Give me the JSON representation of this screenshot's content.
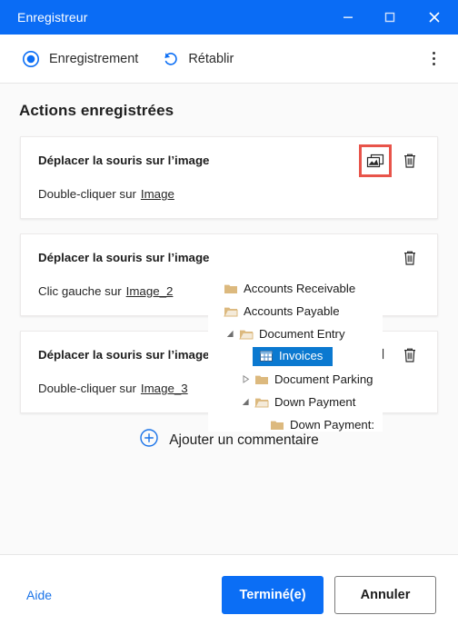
{
  "window": {
    "title": "Enregistreur",
    "controls": {
      "minimize": "minimize",
      "maximize": "maximize",
      "close": "close"
    },
    "accent_color": "#0a6cf5"
  },
  "toolbar": {
    "record_label": "Enregistrement",
    "redo_label": "Rétablir",
    "overflow_label": "more-options"
  },
  "main": {
    "section_title": "Actions enregistrées",
    "cards": [
      {
        "title": "Déplacer la souris sur l’image",
        "action_prefix": "Double-cliquer sur",
        "action_target": "Image",
        "image_button": "image-preview",
        "delete_button": "delete",
        "highlighted": true
      },
      {
        "title": "Déplacer la souris sur l’image",
        "action_prefix": "Clic gauche sur",
        "action_target": "Image_2",
        "image_button": "image-preview",
        "delete_button": "delete",
        "highlighted": false
      },
      {
        "title": "Déplacer la souris sur l’image",
        "action_prefix": "Double-cliquer sur",
        "action_target": "Image_3",
        "image_button": "image-preview",
        "delete_button": "delete",
        "highlighted": false
      }
    ],
    "add_comment_label": "Ajouter un commentaire"
  },
  "tree_overlay": {
    "rows": [
      {
        "label": "Accounts Receivable",
        "indent": 0,
        "icon": "folder-closed",
        "expander": "none",
        "selected": false
      },
      {
        "label": "Accounts Payable",
        "indent": 0,
        "icon": "folder-open",
        "expander": "none",
        "selected": false
      },
      {
        "label": "Document Entry",
        "indent": 1,
        "icon": "folder-open",
        "expander": "expanded",
        "selected": false
      },
      {
        "label": "Invoices",
        "indent": 2,
        "icon": "table-grid",
        "expander": "none",
        "selected": true
      },
      {
        "label": "Document Parking",
        "indent": 2,
        "icon": "folder-closed",
        "expander": "collapsed",
        "selected": false
      },
      {
        "label": "Down Payment",
        "indent": 2,
        "icon": "folder-open",
        "expander": "expanded",
        "selected": false
      },
      {
        "label": "Down Payment:",
        "indent": 3,
        "icon": "folder-closed",
        "expander": "none",
        "selected": false
      }
    ],
    "selection_color": "#0b79d0",
    "folder_color": "#dcb97e"
  },
  "footer": {
    "help_label": "Aide",
    "primary_label": "Terminé(e)",
    "secondary_label": "Annuler"
  }
}
